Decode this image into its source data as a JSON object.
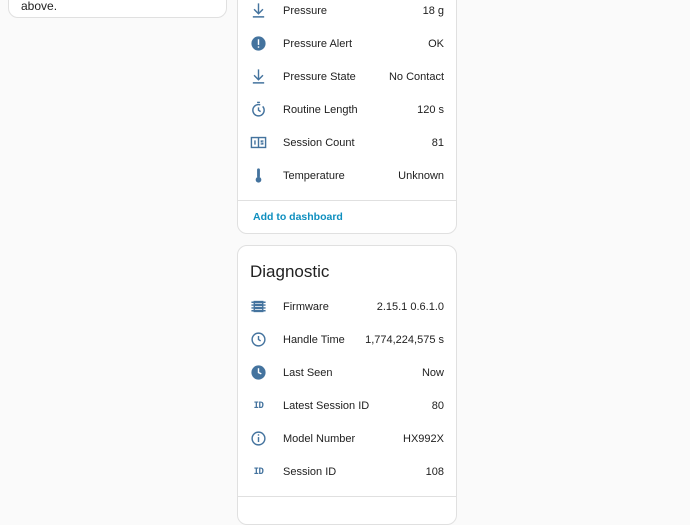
{
  "left_card": {
    "text_fragment": "above."
  },
  "sensors": {
    "rows": [
      {
        "icon": "arrow-down-to-line-icon",
        "label": "Pressure",
        "value": "18 g"
      },
      {
        "icon": "alert-circle-icon",
        "label": "Pressure Alert",
        "value": "OK"
      },
      {
        "icon": "arrow-down-to-line-icon",
        "label": "Pressure State",
        "value": "No Contact"
      },
      {
        "icon": "timer-icon",
        "label": "Routine Length",
        "value": "120 s"
      },
      {
        "icon": "counter-icon",
        "label": "Session Count",
        "value": "81"
      },
      {
        "icon": "thermometer-icon",
        "label": "Temperature",
        "value": "Unknown"
      }
    ],
    "add_to_dashboard": "Add to dashboard"
  },
  "diagnostic": {
    "title": "Diagnostic",
    "rows": [
      {
        "icon": "memory-chip-icon",
        "label": "Firmware",
        "value": "2.15.1 0.6.1.0"
      },
      {
        "icon": "clock-outline-icon",
        "label": "Handle Time",
        "value": "1,774,224,575 s"
      },
      {
        "icon": "clock-filled-icon",
        "label": "Last Seen",
        "value": "Now"
      },
      {
        "icon": "identifier-icon",
        "label": "Latest Session ID",
        "value": "80"
      },
      {
        "icon": "information-outline-icon",
        "label": "Model Number",
        "value": "HX992X"
      },
      {
        "icon": "identifier-icon",
        "label": "Session ID",
        "value": "108"
      }
    ],
    "id_icon_text": "ID"
  },
  "colors": {
    "icon": "#44739e",
    "link": "#0f8fbf",
    "background": "#fafafa",
    "card": "#ffffff",
    "divider": "#e0e0e0"
  }
}
